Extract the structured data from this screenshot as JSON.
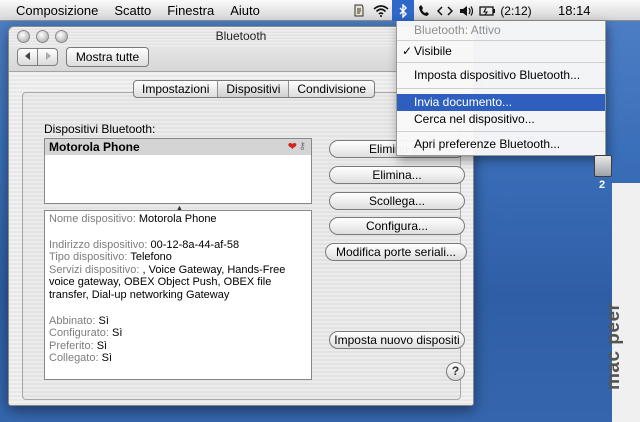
{
  "menubar": {
    "items": [
      "Composizione",
      "Scatto",
      "Finestra",
      "Aiuto"
    ],
    "battery": "(2:12)",
    "clock": "18:14"
  },
  "window": {
    "title": "Bluetooth",
    "show_all": "Mostra tutte",
    "tabs": [
      "Impostazioni",
      "Dispositivi",
      "Condivisione"
    ],
    "selected_tab": "Dispositivi",
    "section_label": "Dispositivi Bluetooth:",
    "devices": [
      {
        "name": "Motorola Phone"
      }
    ],
    "info": {
      "nome_label": "Nome dispositivo:",
      "nome_value": "Motorola Phone",
      "indirizzo_label": "Indirizzo dispositivo:",
      "indirizzo_value": "00-12-8a-44-af-58",
      "tipo_label": "Tipo dispositivo:",
      "tipo_value": "Telefono",
      "servizi_label": "Servizi dispositivo:",
      "servizi_value": ", Voice Gateway, Hands-Free",
      "servizi_line2": "voice gateway, OBEX Object Push, OBEX file",
      "servizi_line3": "transfer, Dial-up networking Gateway",
      "abbinato_label": "Abbinato:",
      "abbinato_value": "Sì",
      "configurato_label": "Configurato:",
      "configurato_value": "Sì",
      "preferito_label": "Preferito:",
      "preferito_value": "Sì",
      "collegato_label": "Collegato:",
      "collegato_value": "Sì"
    },
    "buttons": {
      "elimina_da": "Elimina da",
      "elimina": "Elimina...",
      "scollega": "Scollega...",
      "configura": "Configura...",
      "modifica_porte": "Modifica porte seriali...",
      "imposta_nuovo": "Imposta nuovo dispositi",
      "help": "?"
    }
  },
  "dropdown": {
    "status": "Bluetooth: Attivo",
    "visibile": "Visibile",
    "imposta": "Imposta dispositivo Bluetooth...",
    "invia": "Invia documento...",
    "cerca": "Cerca nel dispositivo...",
    "apri": "Apri preferenze Bluetooth...",
    "checkmark": "✓"
  },
  "desktop": {
    "icon_label": "2",
    "watermark": "mac peer"
  },
  "colors": {
    "desktop": "#3a6fb9",
    "highlight": "#2e5fbf",
    "heart": "#d42222"
  }
}
